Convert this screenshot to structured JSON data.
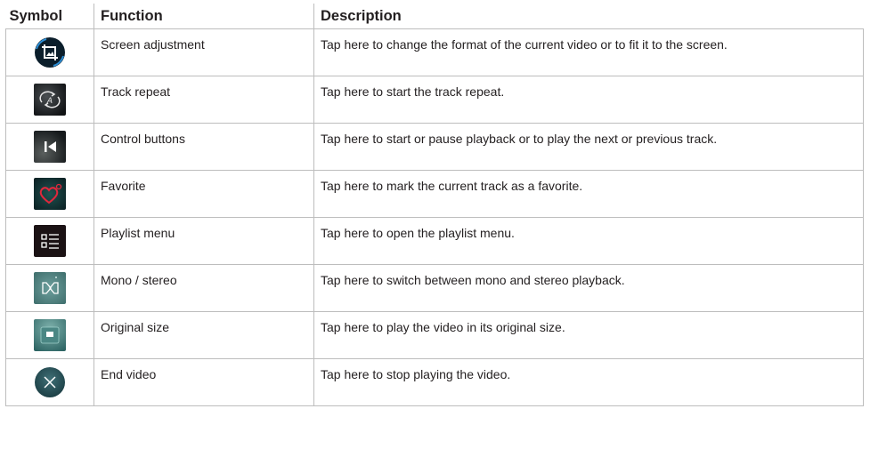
{
  "table": {
    "headers": {
      "symbol": "Symbol",
      "function": "Function",
      "description": "Description"
    },
    "rows": [
      {
        "icon": "screen-adjustment-icon",
        "function": "Screen adjustment",
        "description": "Tap here to change the format of the current video or to fit it to the screen."
      },
      {
        "icon": "track-repeat-icon",
        "function": "Track repeat",
        "description": "Tap here to start the track repeat."
      },
      {
        "icon": "previous-track-icon",
        "function": "Control buttons",
        "description": "Tap here to start or pause playback or to play the next or previous track."
      },
      {
        "icon": "favorite-heart-icon",
        "function": "Favorite",
        "description": "Tap here to mark the current track as a favorite."
      },
      {
        "icon": "playlist-menu-icon",
        "function": "Playlist menu",
        "description": "Tap here to open the playlist menu."
      },
      {
        "icon": "mono-stereo-icon",
        "function": "Mono / stereo",
        "description": "Tap here to switch between mono and stereo playback."
      },
      {
        "icon": "original-size-icon",
        "function": "Original size",
        "description": "Tap here to play the video in its original size."
      },
      {
        "icon": "end-video-icon",
        "function": "End video",
        "description": "Tap here to stop playing the video."
      }
    ]
  }
}
